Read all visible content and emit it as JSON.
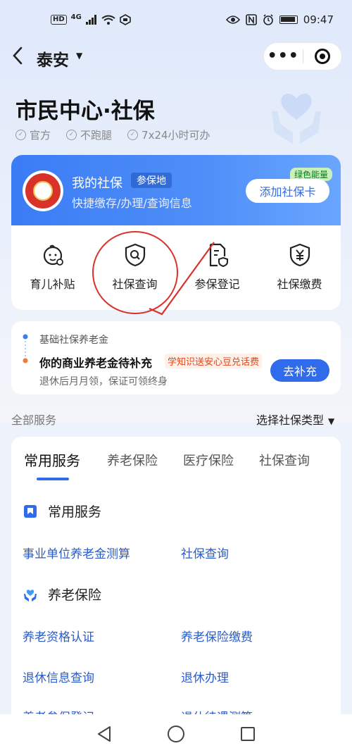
{
  "status_bar": {
    "network": "HD",
    "signal": "4G",
    "time": "09:47"
  },
  "header": {
    "back_icon": "chevron-left-icon",
    "city": "泰安",
    "more": "•••"
  },
  "page": {
    "title": "市民中心·社保",
    "badges": [
      "官方",
      "不跑腿",
      "7x24小时可办"
    ]
  },
  "my_card": {
    "title": "我的社保",
    "location_tag": "参保地",
    "subtitle": "快捷缴存/办理/查询信息",
    "energy_tag": "绿色能量",
    "add_button": "添加社保卡",
    "services": [
      {
        "label": "育儿补贴",
        "icon": "baby-icon"
      },
      {
        "label": "社保查询",
        "icon": "shield-search-icon"
      },
      {
        "label": "参保登记",
        "icon": "document-shield-icon"
      },
      {
        "label": "社保缴费",
        "icon": "yuan-shield-icon"
      }
    ]
  },
  "pension": {
    "caption": "基础社保养老金",
    "title": "你的商业养老金待补充",
    "promo": "学知识送安心豆兑话费",
    "subtitle": "退休后月月领，保证可领终身",
    "button": "去补充"
  },
  "all_services": {
    "label": "全部服务",
    "type_select": "选择社保类型"
  },
  "tabs": [
    "常用服务",
    "养老保险",
    "医疗保险",
    "社保查询"
  ],
  "categories": [
    {
      "title": "常用服务",
      "icon": "bookmark-icon",
      "items": [
        "事业单位养老金测算",
        "社保查询"
      ]
    },
    {
      "title": "养老保险",
      "icon": "hands-heart-icon",
      "items": [
        "养老资格认证",
        "养老保险缴费",
        "退休信息查询",
        "退休办理",
        "养老参保登记",
        "退休待遇测算"
      ]
    }
  ],
  "colors": {
    "primary": "#2f6bea",
    "accent_red": "#d8322b",
    "promo": "#e0451f"
  }
}
